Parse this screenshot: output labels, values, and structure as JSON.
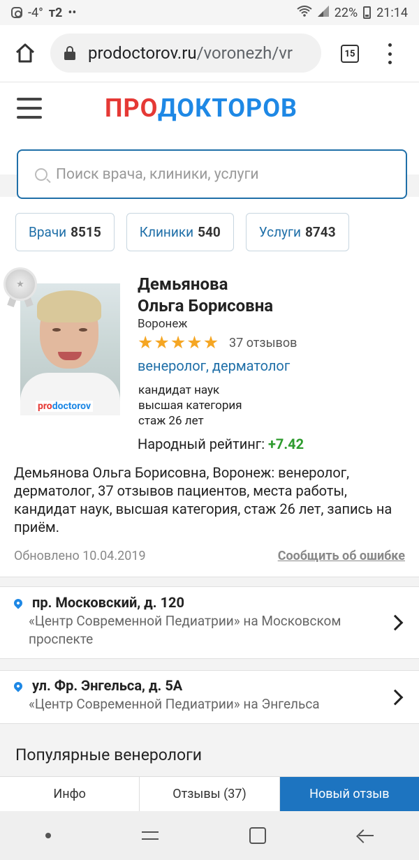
{
  "status_bar": {
    "left_text": "-4°",
    "carrier": "т2",
    "dots": "••",
    "battery_pct": "22%",
    "time": "21:14"
  },
  "browser": {
    "url_host": "prodoctorov.ru",
    "url_path": "/voronezh/vr",
    "tab_count": "15"
  },
  "site": {
    "logo_part1": "ПРО",
    "logo_part2": "ДОКТОРОВ",
    "search_placeholder": "Поиск врача, клиники, услуги",
    "categories": [
      {
        "label": "Врачи",
        "count": "8515"
      },
      {
        "label": "Клиники",
        "count": "540"
      },
      {
        "label": "Услуги",
        "count": "8743"
      }
    ]
  },
  "doctor": {
    "last_name": "Демьянова",
    "first_middle": "Ольга Борисовна",
    "city": "Воронеж",
    "stars": 5,
    "reviews": "37 отзывов",
    "specialties": "венеролог, дерматолог",
    "qualifications": [
      "кандидат наук",
      "высшая категория",
      "стаж 26 лет"
    ],
    "rating_label": "Народный рейтинг:",
    "rating_value": "+7.42",
    "photo_watermark_1": "pro",
    "photo_watermark_2": "doctorov",
    "description": "Демьянова Ольга Борисовна, Воронеж: венеролог, дерматолог, 37 отзывов пациентов, места работы, кандидат наук, высшая категория, стаж 26 лет, запись на приём.",
    "updated": "Обновлено 10.04.2019",
    "report_link": "Сообщить об ошибке"
  },
  "addresses": [
    {
      "street": "пр. Московский, д. 120",
      "clinic": "«Центр Современной Педиатрии» на Московском проспекте"
    },
    {
      "street": "ул. Фр. Энгельса, д. 5А",
      "clinic": "«Центр Современной Педиатрии» на Энгельса"
    }
  ],
  "popular_title": "Популярные венерологи",
  "bottom_tabs": [
    "Инфо",
    "Отзывы (37)",
    "Новый отзыв"
  ],
  "colors": {
    "accent": "#1d74c0",
    "logo_red": "#e53935",
    "logo_blue": "#1e88e5",
    "rating_green": "#2e9b2e",
    "star": "#f5a623"
  }
}
